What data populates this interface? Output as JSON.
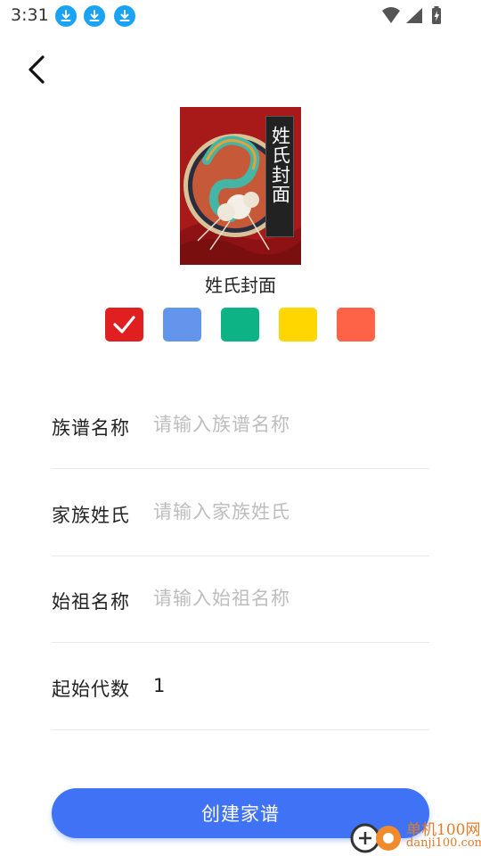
{
  "status_bar": {
    "time": "3:31",
    "download_icons": [
      "download-icon",
      "download-icon",
      "download-icon"
    ],
    "system_icons": [
      "wifi-icon",
      "signal-icon",
      "battery-icon"
    ]
  },
  "nav": {
    "back_icon": "chevron-left-icon"
  },
  "cover": {
    "title": "姓氏封面",
    "caption": "姓氏封面",
    "colors": {
      "background": "#a8191a",
      "strip": "#222222"
    }
  },
  "swatches": [
    {
      "color": "#e02020",
      "selected": true
    },
    {
      "color": "#6495ed",
      "selected": false
    },
    {
      "color": "#0db384",
      "selected": false
    },
    {
      "color": "#ffd600",
      "selected": false
    },
    {
      "color": "#ff6347",
      "selected": false
    }
  ],
  "form": {
    "fields": [
      {
        "label": "族谱名称",
        "placeholder": "请输入族谱名称",
        "value": ""
      },
      {
        "label": "家族姓氏",
        "placeholder": "请输入家族姓氏",
        "value": ""
      },
      {
        "label": "始祖名称",
        "placeholder": "请输入始祖名称",
        "value": ""
      },
      {
        "label": "起始代数",
        "placeholder": "",
        "value": "1"
      }
    ]
  },
  "create_button": {
    "label": "创建家谱",
    "color": "#3f72f5"
  },
  "watermark": {
    "line1": "单机100网",
    "line2": "danji100.com"
  }
}
